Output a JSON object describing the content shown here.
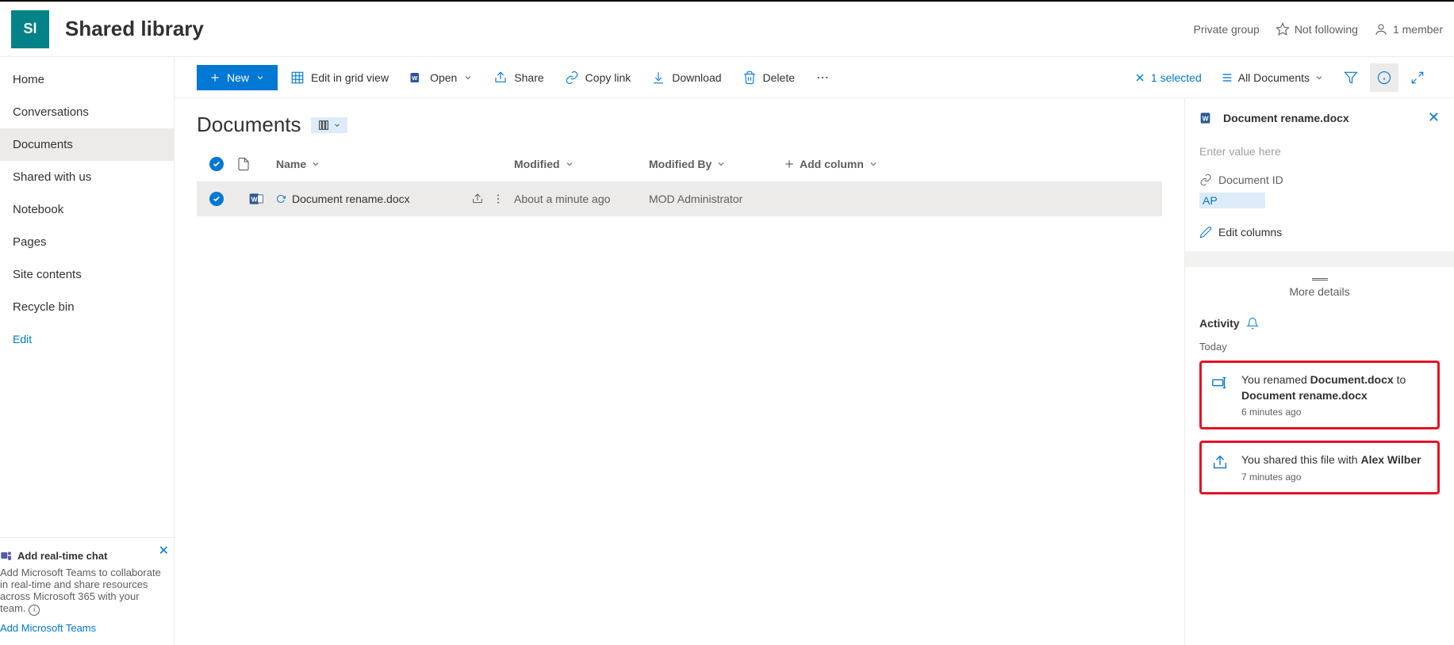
{
  "site": {
    "icon_text": "Sl",
    "title": "Shared library"
  },
  "header": {
    "group_type": "Private group",
    "follow": "Not following",
    "members": "1 member"
  },
  "nav": {
    "items": [
      "Home",
      "Conversations",
      "Documents",
      "Shared with us",
      "Notebook",
      "Pages",
      "Site contents",
      "Recycle bin"
    ],
    "edit": "Edit"
  },
  "teams_promo": {
    "title": "Add real-time chat",
    "body": "Add Microsoft Teams to collaborate in real-time and share resources across Microsoft 365 with your team.",
    "link": "Add Microsoft Teams"
  },
  "toolbar": {
    "new": "New",
    "edit_grid": "Edit in grid view",
    "open": "Open",
    "share": "Share",
    "copy_link": "Copy link",
    "download": "Download",
    "delete": "Delete",
    "selected": "1 selected",
    "view": "All Documents"
  },
  "library": {
    "title": "Documents",
    "columns": {
      "name": "Name",
      "modified": "Modified",
      "modified_by": "Modified By",
      "add": "Add column"
    },
    "rows": [
      {
        "name": "Document rename.docx",
        "modified": "About a minute ago",
        "modified_by": "MOD Administrator"
      }
    ]
  },
  "details": {
    "file_name": "Document rename.docx",
    "enter_placeholder": "Enter value here",
    "doc_id_label": "Document ID",
    "doc_id_value": "AP",
    "edit_columns": "Edit columns",
    "more_details": "More details",
    "activity_label": "Activity",
    "today_label": "Today",
    "activities": [
      {
        "text_pre": "You renamed ",
        "bold1": "Document.docx",
        "mid": " to ",
        "bold2": "Document rename.docx",
        "time": "6 minutes ago"
      },
      {
        "text_pre": "You shared this file with ",
        "bold1": "Alex Wilber",
        "mid": "",
        "bold2": "",
        "time": "7 minutes ago"
      }
    ]
  }
}
